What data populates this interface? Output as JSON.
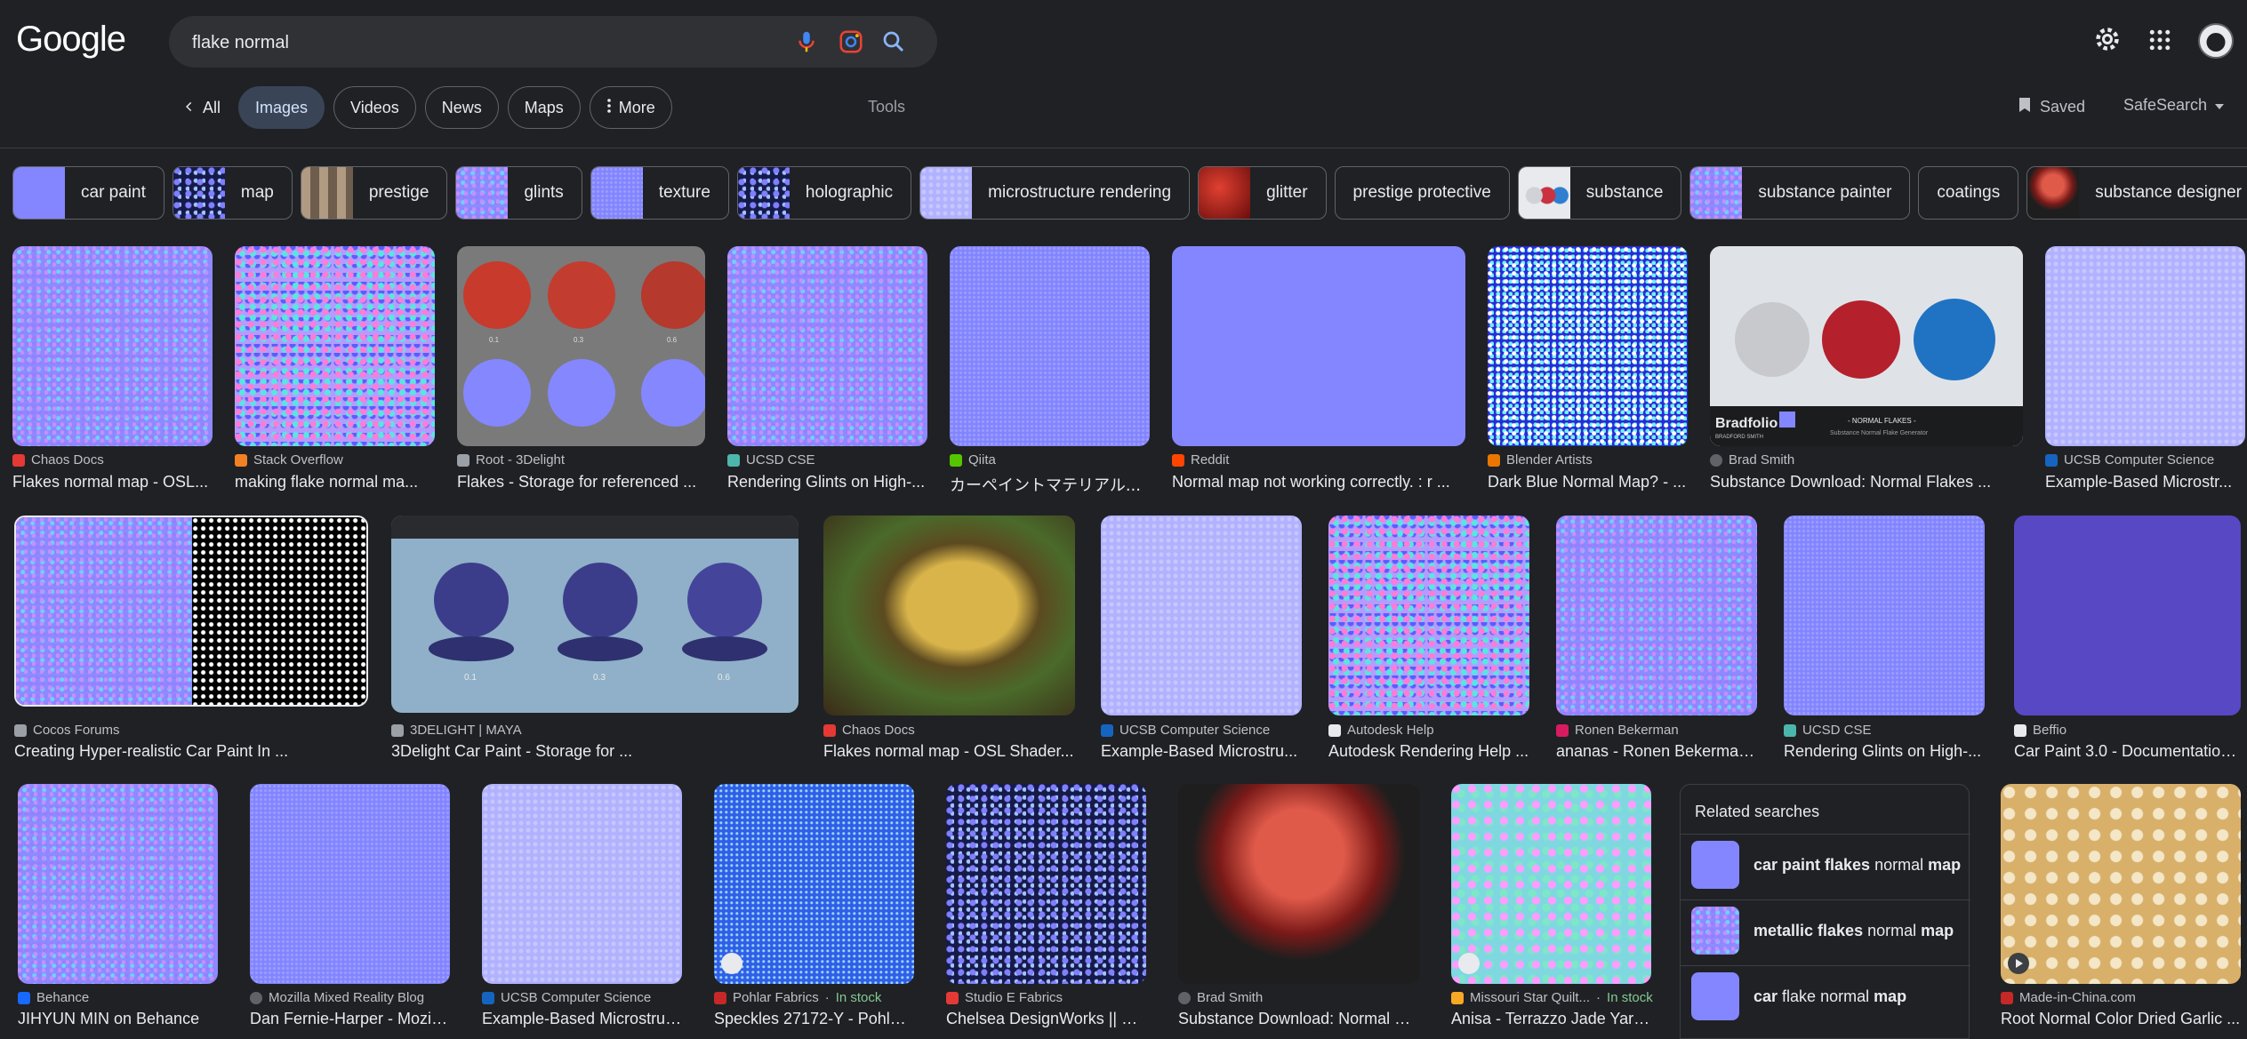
{
  "header": {
    "logo": "Google",
    "search_value": "flake normal",
    "mic_icon": "mic-icon",
    "lens_icon": "lens-icon",
    "search_icon": "search-icon",
    "settings_icon": "gear-icon",
    "apps_icon": "apps-grid-icon"
  },
  "tabs": {
    "back_all": "All",
    "images": "Images",
    "videos": "Videos",
    "news": "News",
    "maps": "Maps",
    "more": "More",
    "tools": "Tools",
    "saved": "Saved",
    "safesearch": "SafeSearch"
  },
  "chips": [
    {
      "label": "car paint"
    },
    {
      "label": "map"
    },
    {
      "label": "prestige"
    },
    {
      "label": "glints"
    },
    {
      "label": "texture"
    },
    {
      "label": "holographic"
    },
    {
      "label": "microstructure rendering"
    },
    {
      "label": "glitter"
    },
    {
      "label": "prestige protective"
    },
    {
      "label": "substance"
    },
    {
      "label": "substance painter"
    },
    {
      "label": "coatings"
    },
    {
      "label": "substance designer"
    }
  ],
  "row1": [
    {
      "source": "Chaos Docs",
      "title": "Flakes normal map - OSL..."
    },
    {
      "source": "Stack Overflow",
      "title": "making flake normal ma..."
    },
    {
      "source": "Root - 3Delight",
      "title": "Flakes - Storage for referenced ..."
    },
    {
      "source": "UCSD CSE",
      "title": "Rendering Glints on High-..."
    },
    {
      "source": "Qiita",
      "title": "カーペイントマテリアル..."
    },
    {
      "source": "Reddit",
      "title": "Normal map not working correctly. : r ..."
    },
    {
      "source": "Blender Artists",
      "title": "Dark Blue Normal Map? - ..."
    },
    {
      "source": "Brad Smith",
      "title": "Substance Download: Normal Flakes ..."
    },
    {
      "source": "UCSB Computer Science",
      "title": "Example-Based Microstr..."
    }
  ],
  "row2": [
    {
      "source": "Cocos Forums",
      "title": "Creating Hyper-realistic Car Paint In ..."
    },
    {
      "source": "3DELIGHT | MAYA",
      "title": "3Delight Car Paint - Storage for ..."
    },
    {
      "source": "Chaos Docs",
      "title": "Flakes normal map - OSL Shader..."
    },
    {
      "source": "UCSB Computer Science",
      "title": "Example-Based Microstru..."
    },
    {
      "source": "Autodesk Help",
      "title": "Autodesk Rendering Help ..."
    },
    {
      "source": "Ronen Bekerman",
      "title": "ananas - Ronen Bekerman..."
    },
    {
      "source": "UCSD CSE",
      "title": "Rendering Glints on High-..."
    },
    {
      "source": "Beffio",
      "title": "Car Paint 3.0 - Documentation..."
    }
  ],
  "row3": [
    {
      "source": "Behance",
      "title": "JIHYUN MIN on Behance",
      "stock": ""
    },
    {
      "source": "Mozilla Mixed Reality Blog",
      "title": "Dan Fernie-Harper - Mozill...",
      "stock": ""
    },
    {
      "source": "UCSB Computer Science",
      "title": "Example-Based Microstruc...",
      "stock": ""
    },
    {
      "source": "Pohlar Fabrics",
      "title": "Speckles 27172-Y - Pohlar ...",
      "stock": "In stock"
    },
    {
      "source": "Studio E Fabrics",
      "title": "Chelsea DesignWorks || Da...",
      "stock": ""
    },
    {
      "source": "Brad Smith",
      "title": "Substance Download: Normal Fl...",
      "stock": ""
    },
    {
      "source": "Missouri Star Quilt...",
      "title": "Anisa - Terrazzo Jade Yard...",
      "stock": "In stock"
    },
    {
      "source": "Made-in-China.com",
      "title": "Root Normal Color Dried Garlic ...",
      "stock": ""
    }
  ],
  "related": {
    "heading": "Related searches",
    "items": [
      {
        "bold1": "car paint flakes",
        "normal": "normal",
        "bold2": "map"
      },
      {
        "bold1": "metallic flakes",
        "normal": "normal",
        "bold2": "map"
      },
      {
        "bold1": "car",
        "normal": "flake normal",
        "bold2": "map"
      }
    ]
  },
  "image_texts": {
    "sphere_labels": [
      "0.1",
      "0.3",
      "0.6"
    ],
    "bradfolio": "Bradfolio",
    "bradfolio_sub": "BRADFORD SMITH",
    "normal_flakes": "- NORMAL FLAKES -",
    "normal_flakes_sub": "Substance Normal Flake Generator"
  }
}
